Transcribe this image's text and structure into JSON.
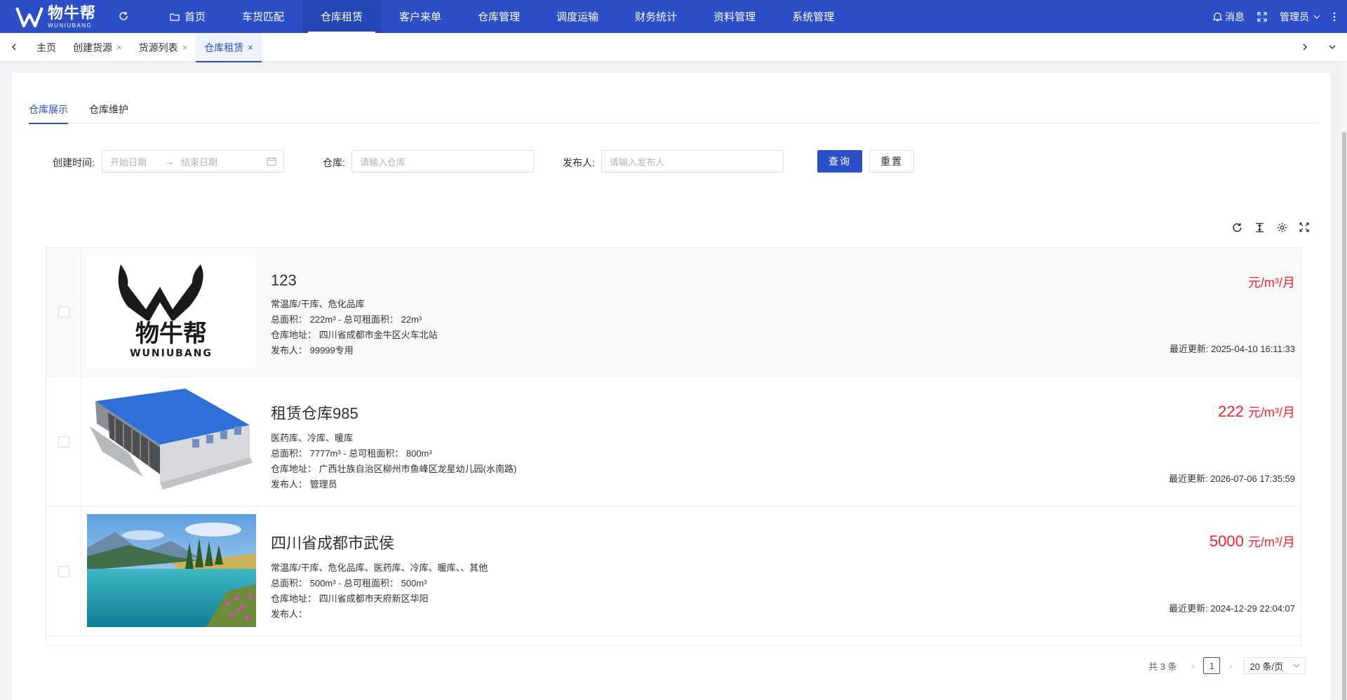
{
  "brand": {
    "name_cn": "物牛帮",
    "name_en": "WUNIUBANG",
    "nav_color": "#2c4fc7"
  },
  "nav": {
    "items": [
      "首页",
      "车货匹配",
      "仓库租赁",
      "客户来单",
      "仓库管理",
      "调度运输",
      "财务统计",
      "资料管理",
      "系统管理"
    ],
    "active": "仓库租赁",
    "messages": "消息",
    "user": "管理员"
  },
  "tags": {
    "items": [
      {
        "label": "主页",
        "closable": false
      },
      {
        "label": "创建货源",
        "closable": true
      },
      {
        "label": "货源列表",
        "closable": true
      },
      {
        "label": "仓库租赁",
        "closable": true,
        "active": true
      }
    ],
    "close_glyph": "×"
  },
  "subtabs": {
    "items": [
      "仓库展示",
      "仓库维护"
    ],
    "active": "仓库展示"
  },
  "filters": {
    "created_label": "创建时间:",
    "start_placeholder": "开始日期",
    "end_placeholder": "结束日期",
    "warehouse_label": "仓库:",
    "warehouse_placeholder": "请输入仓库",
    "publisher_label": "发布人:",
    "publisher_placeholder": "请输入发布人",
    "query_button": "查询",
    "reset_button": "重置"
  },
  "list": {
    "rows": [
      {
        "title": "123",
        "types": "常温库/干库、危化品库",
        "area_line": "总面积： 222m³ - 总可租面积： 22m³",
        "address_line": "仓库地址： 四川省成都市金牛区火车北站",
        "publisher_line": "发布人： 99999专用",
        "price": "",
        "price_unit": "元/m³/月",
        "updated": "最近更新: 2025-04-10 16:11:33",
        "image": "logo"
      },
      {
        "title": "租赁仓库985",
        "types": "医药库、冷库、暖库",
        "area_line": "总面积： 7777m³ - 总可租面积： 800m³",
        "address_line": "仓库地址： 广西壮族自治区柳州市鱼峰区龙星幼儿园(水南路)",
        "publisher_line": "发布人： 管理员",
        "price": "222",
        "price_unit": "元/m³/月",
        "updated": "最近更新: 2026-07-06 17:35:59",
        "image": "warehouse"
      },
      {
        "title": "四川省成都市武侯",
        "types": "常温库/干库、危化品库、医药库、冷库、暖库、、其他",
        "area_line": "总面积： 500m³ - 总可租面积： 500m³",
        "address_line": "仓库地址： 四川省成都市天府新区华阳",
        "publisher_line": "发布人：",
        "price": "5000",
        "price_unit": "元/m³/月",
        "updated": "最近更新: 2024-12-29 22:04:07",
        "image": "lake"
      }
    ]
  },
  "pagination": {
    "total_text": "共 3 条",
    "current_page": "1",
    "page_size": "20 条/页"
  },
  "colors": {
    "primary": "#2c4fc7",
    "price": "#f5222d"
  }
}
